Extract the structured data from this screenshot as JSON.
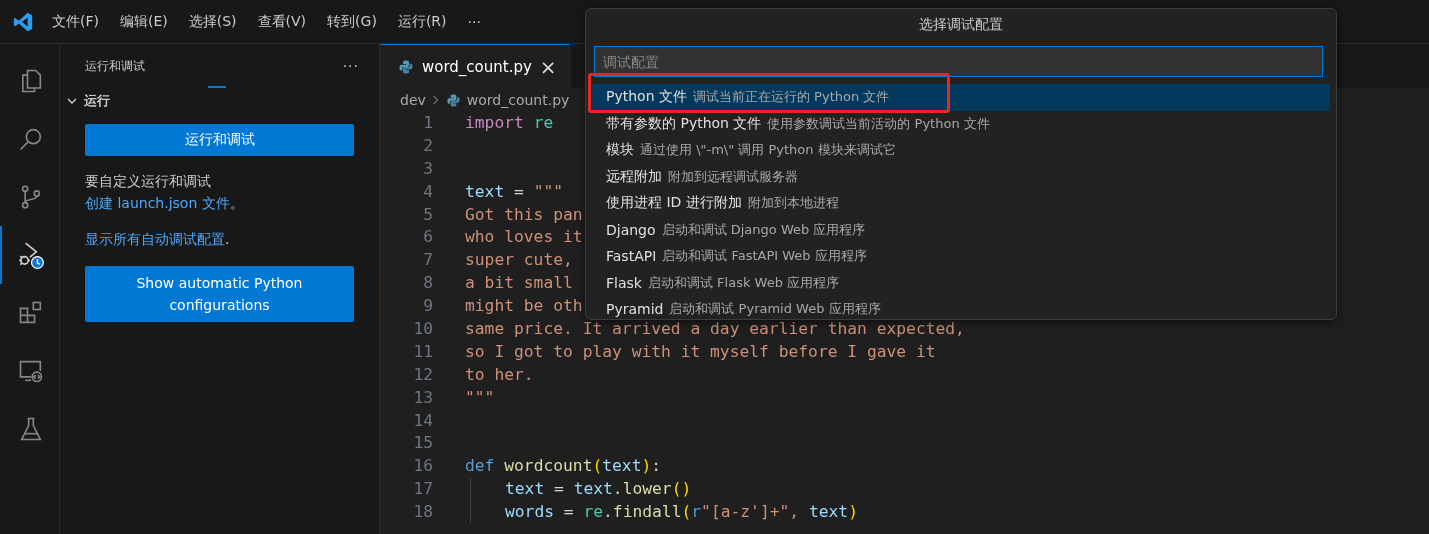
{
  "menu_bar": {
    "items": [
      "文件(F)",
      "编辑(E)",
      "选择(S)",
      "查看(V)",
      "转到(G)",
      "运行(R)",
      "···"
    ]
  },
  "activity_bar": [
    {
      "kind": "files",
      "selected": false
    },
    {
      "kind": "search",
      "selected": false
    },
    {
      "kind": "branch",
      "selected": false
    },
    {
      "kind": "debug",
      "selected": true
    },
    {
      "kind": "blocks",
      "selected": false
    },
    {
      "kind": "remote",
      "selected": false
    },
    {
      "kind": "flask",
      "selected": false
    }
  ],
  "sidebar": {
    "title": "运行和调试",
    "more": "···",
    "section": {
      "label": "运行",
      "expanded": true
    },
    "run_button": "运行和调试",
    "hint": {
      "text": "要自定义运行和调试",
      "link": "创建 launch.json 文件",
      "after": "。"
    },
    "auto_link": {
      "link": "显示所有自动调试配置",
      "after": "."
    },
    "python_button": "Show automatic Python configurations"
  },
  "tabs": [
    {
      "label": "word_count.py",
      "selected": true,
      "close": "×"
    }
  ],
  "breadcrumb": [
    "dev",
    "word_count.py"
  ],
  "code": [
    {
      "n": "1",
      "tokens": [
        {
          "t": "import ",
          "kind": "keyword"
        },
        {
          "t": "re",
          "kind": "module"
        }
      ]
    },
    {
      "n": "2"
    },
    {
      "n": "3"
    },
    {
      "n": "4",
      "tokens": [
        {
          "t": "text ",
          "kind": "variable"
        },
        {
          "t": "= ",
          "kind": "operator"
        },
        {
          "t": "\"\"\"",
          "kind": "string"
        }
      ]
    },
    {
      "n": "5",
      "tokens": [
        {
          "t": "Got this pan",
          "kind": "string"
        }
      ]
    },
    {
      "n": "6",
      "tokens": [
        {
          "t": "who loves it",
          "kind": "string"
        }
      ]
    },
    {
      "n": "7",
      "tokens": [
        {
          "t": "super cute,",
          "kind": "string"
        }
      ]
    },
    {
      "n": "8",
      "tokens": [
        {
          "t": "a bit small",
          "kind": "string"
        }
      ]
    },
    {
      "n": "9",
      "tokens": [
        {
          "t": "might be oth",
          "kind": "string"
        }
      ]
    },
    {
      "n": "10",
      "tokens": [
        {
          "t": "same price. It arrived a day earlier than expected,",
          "kind": "string"
        }
      ]
    },
    {
      "n": "11",
      "tokens": [
        {
          "t": "so I got to play with it myself before I gave it",
          "kind": "string"
        }
      ]
    },
    {
      "n": "12",
      "tokens": [
        {
          "t": "to her.",
          "kind": "string"
        }
      ]
    },
    {
      "n": "13",
      "tokens": [
        {
          "t": "\"\"\"",
          "kind": "string"
        }
      ]
    },
    {
      "n": "14"
    },
    {
      "n": "15"
    },
    {
      "n": "16",
      "tokens": [
        {
          "t": "def ",
          "kind": "storage"
        },
        {
          "t": "wordcount",
          "kind": "function"
        },
        {
          "t": "(",
          "kind": "bracket"
        },
        {
          "t": "text",
          "kind": "variable"
        },
        {
          "t": ")",
          "kind": "bracket"
        },
        {
          "t": ":",
          "kind": "operator"
        }
      ]
    },
    {
      "n": "17",
      "indent": true,
      "tokens": [
        {
          "t": "text ",
          "kind": "variable"
        },
        {
          "t": "= ",
          "kind": "operator"
        },
        {
          "t": "text",
          "kind": "variable"
        },
        {
          "t": ".",
          "kind": "operator"
        },
        {
          "t": "lower",
          "kind": "function"
        },
        {
          "t": "()",
          "kind": "bracket"
        }
      ]
    },
    {
      "n": "18",
      "indent": true,
      "tokens": [
        {
          "t": "words ",
          "kind": "variable"
        },
        {
          "t": "= ",
          "kind": "operator"
        },
        {
          "t": "re",
          "kind": "module"
        },
        {
          "t": ".",
          "kind": "operator"
        },
        {
          "t": "findall",
          "kind": "function"
        },
        {
          "t": "(",
          "kind": "bracket"
        },
        {
          "t": "r",
          "kind": "storage"
        },
        {
          "t": "\"[a-z']+\",",
          "kind": "string"
        },
        {
          "t": " text",
          "kind": "variable"
        },
        {
          "t": ")",
          "kind": "bracket"
        }
      ]
    }
  ],
  "quick_pick": {
    "title": "选择调试配置",
    "placeholder": "调试配置",
    "items": [
      {
        "label": "Python 文件",
        "description": "调试当前正在运行的 Python 文件",
        "selected": true,
        "outlined": true
      },
      {
        "label": "带有参数的 Python 文件",
        "description": "使用参数调试当前活动的 Python 文件",
        "selected": false,
        "outlined": false
      },
      {
        "label": "模块",
        "description": "通过使用 \\\"-m\\\" 调用 Python 模块来调试它",
        "selected": false,
        "outlined": false
      },
      {
        "label": "远程附加",
        "description": "附加到远程调试服务器",
        "selected": false,
        "outlined": false
      },
      {
        "label": "使用进程 ID 进行附加",
        "description": "附加到本地进程",
        "selected": false,
        "outlined": false
      },
      {
        "label": "Django",
        "description": "启动和调试 Django Web 应用程序",
        "selected": false,
        "outlined": false
      },
      {
        "label": "FastAPI",
        "description": "启动和调试 FastAPI Web 应用程序",
        "selected": false,
        "outlined": false
      },
      {
        "label": "Flask",
        "description": "启动和调试 Flask Web 应用程序",
        "selected": false,
        "outlined": false
      },
      {
        "label": "Pyramid",
        "description": "启动和调试 Pyramid Web 应用程序",
        "selected": false,
        "outlined": false
      }
    ]
  }
}
